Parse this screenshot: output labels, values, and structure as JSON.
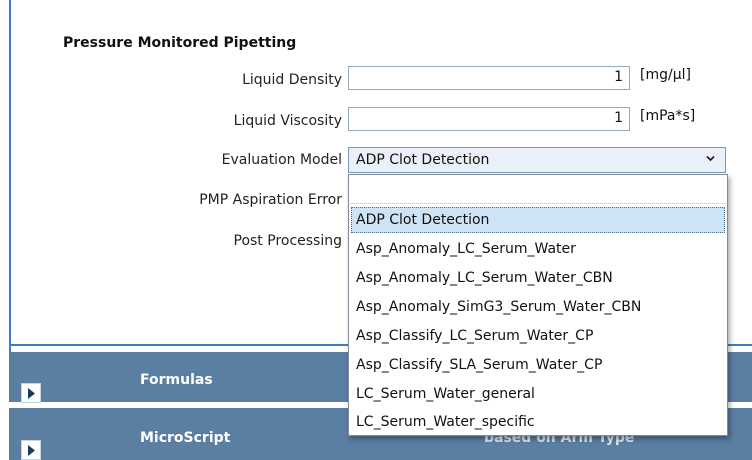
{
  "section_title": "Pressure Monitored Pipetting",
  "fields": {
    "liquid_density": {
      "label": "Liquid Density",
      "value": "1",
      "unit": "[mg/µl]"
    },
    "liquid_viscosity": {
      "label": "Liquid Viscosity",
      "value": "1",
      "unit": "[mPa*s]"
    },
    "evaluation_model": {
      "label": "Evaluation Model",
      "value": "ADP Clot Detection"
    },
    "pmp_aspiration_error": {
      "label": "PMP Aspiration Error"
    },
    "post_processing": {
      "label": "Post Processing"
    }
  },
  "dropdown": {
    "options": [
      "ADP Clot Detection",
      "Asp_Anomaly_LC_Serum_Water",
      "Asp_Anomaly_LC_Serum_Water_CBN",
      "Asp_Anomaly_SimG3_Serum_Water_CBN",
      "Asp_Classify_LC_Serum_Water_CP",
      "Asp_Classify_SLA_Serum_Water_CP",
      "LC_Serum_Water_general",
      "LC_Serum_Water_specific"
    ],
    "selected": "ADP Clot Detection"
  },
  "bars": {
    "formulas": {
      "title": "Formulas"
    },
    "microscript": {
      "title": "MicroScript",
      "partial_text": "based on Arm Type"
    }
  },
  "colors": {
    "accent_border": "#3f7fbf",
    "bar_background": "#5b7ea3",
    "select_background": "#e9f0f8",
    "selected_option": "#cfe3f7"
  }
}
